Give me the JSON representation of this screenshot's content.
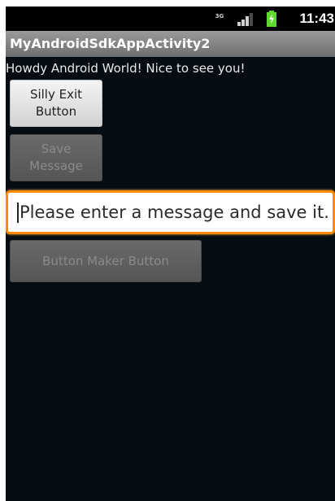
{
  "status_bar": {
    "network_type": "3G",
    "network_icon": "3g-icon",
    "signal_icon": "signal-icon",
    "battery_icon": "battery-icon",
    "time": "11:43"
  },
  "app": {
    "title": "MyAndroidSdkAppActivity2"
  },
  "content": {
    "greeting": "Howdy Android World! Nice to see you!",
    "exit_button_label": "Silly Exit\nButton",
    "save_button_label": "Save\nMessage",
    "message_input_placeholder": "Please enter a message and save it.",
    "maker_button_label": "Button Maker Button"
  },
  "colors": {
    "background": "#050c12",
    "title_bar": "#858585",
    "focus_border": "#ff8a00",
    "battery": "#5ed82c"
  }
}
